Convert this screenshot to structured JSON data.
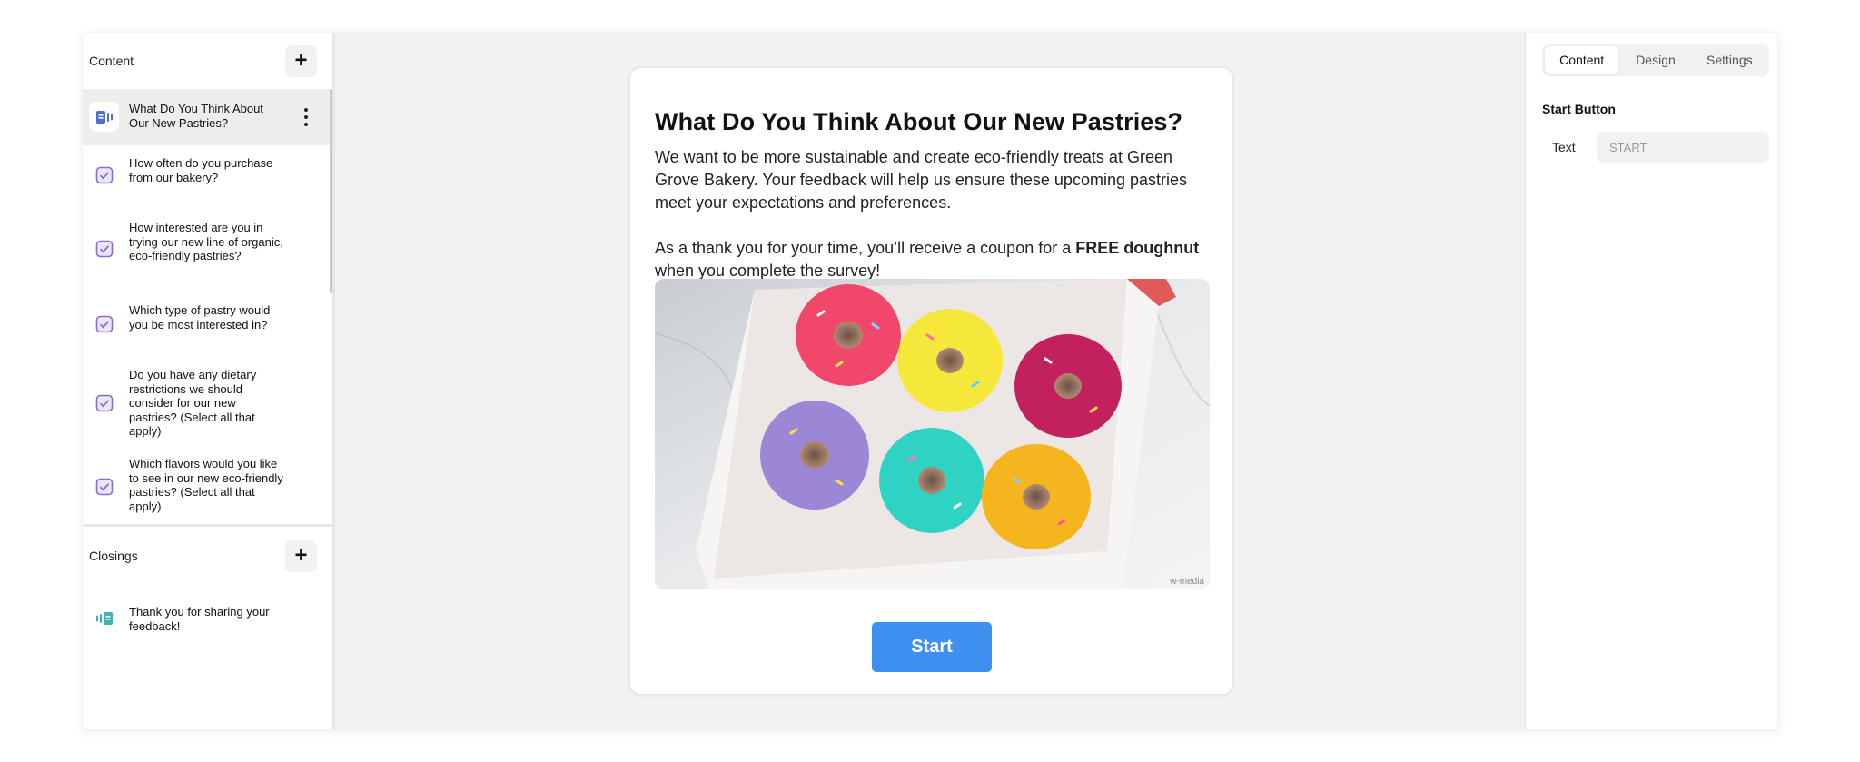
{
  "sidebar": {
    "content_title": "Content",
    "add_label": "+",
    "items": [
      {
        "label": "What Do You Think About Our New Pastries?"
      },
      {
        "label": "How often do you purchase from our bakery?"
      },
      {
        "label": "How interested are you in trying our new line of organic, eco-friendly pastries?"
      },
      {
        "label": "Which type of pastry would you be most interested in?"
      },
      {
        "label": "Do you have any dietary restrictions we should consider for our new pastries? (Select all that apply)"
      },
      {
        "label": "Which flavors would you like to see in our new eco-friendly pastries? (Select all that apply)"
      }
    ],
    "closings_title": "Closings",
    "closings": [
      {
        "label": "Thank you for sharing your feedback!"
      }
    ]
  },
  "card": {
    "title": "What Do You Think About Our New Pastries?",
    "paragraph1": "We want to be more sustainable and create eco-friendly treats at Green Grove Bakery. Your feedback will help us ensure these upcoming pastries meet your expectations and preferences.",
    "paragraph2_pre": "As a thank you for your time, you’ll receive a coupon for a ",
    "paragraph2_bold": "FREE doughnut",
    "paragraph2_post": " when you complete the survey!",
    "image_credit": "w-media",
    "start_label": "Start"
  },
  "right_panel": {
    "tabs": [
      {
        "label": "Content"
      },
      {
        "label": "Design"
      },
      {
        "label": "Settings"
      }
    ],
    "section_title": "Start Button",
    "text_label": "Text",
    "text_placeholder": "START"
  },
  "colors": {
    "accent": "#3d8ff0",
    "question_icon": "#8b6cd6",
    "welcome_icon": "#4a6fd1",
    "closing_icon": "#3fb3b0"
  }
}
